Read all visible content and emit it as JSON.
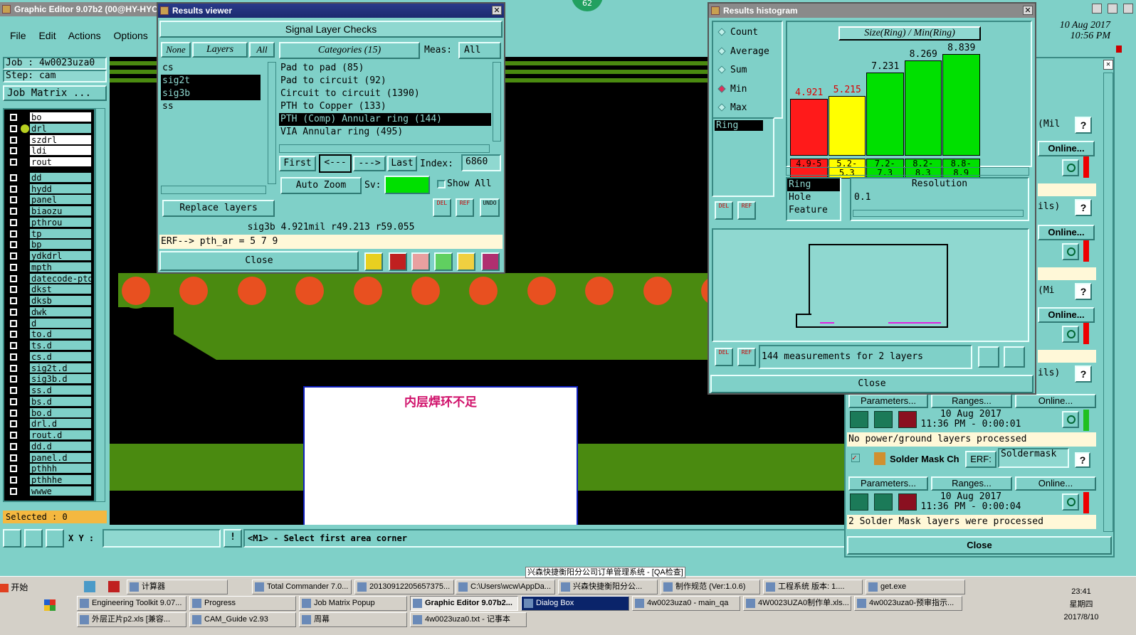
{
  "main": {
    "title": "Graphic Editor 9.07b2 (00@HY-HYCAM",
    "menu": [
      "File",
      "Edit",
      "Actions",
      "Options"
    ],
    "job": "Job : 4w0023uza0",
    "step": "Step: cam",
    "job_matrix": "Job Matrix ...",
    "layers": [
      "bo",
      "drl",
      "szdrl",
      "ldi",
      "rout",
      "dd",
      "hydd",
      "panel",
      "biaozu",
      "pthrou",
      "tp",
      "bp",
      "ydkdrl",
      "mpth",
      "datecode-ptd",
      "dkst",
      "dksb",
      "dwk",
      "d",
      "to.d",
      "ts.d",
      "cs.d",
      "sig2t.d",
      "sig3b.d",
      "ss.d",
      "bs.d",
      "bo.d",
      "drl.d",
      "rout.d",
      "dd.d",
      "panel.d",
      "pthhh",
      "pthhhe",
      "wwwe"
    ],
    "selected": "Selected : 0",
    "xy_label": "X Y :",
    "xy_value": "",
    "status": "<M1> - Select first area corner",
    "date": "10 Aug 2017",
    "time": "10:56 PM",
    "badge": "62",
    "annotation": "内层焊环不足"
  },
  "results": {
    "title": "Results viewer",
    "header": "Signal Layer Checks",
    "none": "None",
    "layers_label": "Layers",
    "all": "All",
    "categories_label": "Categories (15)",
    "meas_label": "Meas:",
    "meas_value": "All",
    "layer_list": [
      "cs",
      "sig2t",
      "sig3b",
      "ss"
    ],
    "categories": [
      "Pad to pad (85)",
      "Pad to circuit (92)",
      "Circuit to circuit (1390)",
      "PTH to Copper (133)",
      "PTH (Comp) Annular ring (144)",
      "VIA Annular ring (495)"
    ],
    "first": "First",
    "prev": "<---",
    "next": "--->",
    "last": "Last",
    "index_label": "Index:",
    "index_value": "6860",
    "auto_zoom": "Auto Zoom",
    "sv": "Sv:",
    "show_all": "Show All",
    "replace_layers": "Replace layers",
    "del": "DEL",
    "ref": "REF",
    "undo": "UNDO",
    "info": "sig3b 4.921mil   r49.213  r59.055",
    "erf": "ERF--> pth_ar = 5 7 9",
    "close": "Close"
  },
  "histogram": {
    "title": "Results histogram",
    "options": [
      "Count",
      "Average",
      "Sum",
      "Min",
      "Max"
    ],
    "selected_option": "Min",
    "list_item": "Ring",
    "chart_title": "Size(Ring) / Min(Ring)",
    "values": [
      "4.921",
      "5.215",
      "7.231",
      "8.269",
      "8.839"
    ],
    "bin_labels": [
      "4.9-5",
      "5.2-5.3",
      "7.2-7.3",
      "8.2-8.3",
      "8.8-8.9"
    ],
    "attrs": [
      "Ring",
      "Hole",
      "Feature"
    ],
    "resolution_label": "Resolution",
    "resolution_value": "0.1",
    "summary": "144 measurements for 2 layers",
    "close": "Close",
    "del": "DEL",
    "ref": "REF"
  },
  "chart_data": {
    "type": "bar",
    "title": "Size(Ring) / Min(Ring)",
    "categories": [
      "4.9-5",
      "5.2-5.3",
      "7.2-7.3",
      "8.2-8.3",
      "8.8-8.9"
    ],
    "values": [
      4.921,
      5.215,
      7.231,
      8.269,
      8.839
    ],
    "colors": [
      "#ff1a1a",
      "#ffff00",
      "#00e000",
      "#00e000",
      "#00e000"
    ]
  },
  "analysis": {
    "items": [
      {
        "label": "(Mil"
      },
      {
        "label": "Online..."
      },
      {
        "label": "ils)"
      },
      {
        "label": "Online..."
      },
      {
        "label": "(Mi"
      },
      {
        "label": "Online..."
      },
      {
        "label": "ils)"
      }
    ],
    "params": "Parameters...",
    "ranges": "Ranges...",
    "online": "Online...",
    "date1": "10 Aug 2017",
    "time1": "11:36 PM - 0:00:01",
    "msg1": "No power/ground layers processed",
    "solder": "Solder Mask Ch",
    "erf": "ERF:",
    "erf_value": "Soldermask",
    "date2": "10 Aug 2017",
    "time2": "11:36 PM - 0:00:04",
    "msg2": "2 Solder Mask layers were processed",
    "close": "Close",
    "help": "?"
  },
  "taskbar": {
    "start": "开始",
    "floating_title": "兴森快捷衡阳分公司订单管理系统 - [QA检查]",
    "row1": [
      "计算器",
      "Total Commander 7.0...",
      "20130912205657375...",
      "C:\\Users\\wcw\\AppDa...",
      "兴森快捷衡阳分公...",
      "制作规范 (Ver:1.0.6)",
      "工程系统  版本: 1....",
      "get.exe"
    ],
    "row2": [
      "Engineering Toolkit 9.07...",
      "Progress",
      "Job Matrix Popup",
      "Graphic Editor 9.07b2...",
      "Dialog Box",
      "4w0023uza0 - main_qa",
      "4W0023UZA0制作单.xls...",
      "4w0023uza0-预审指示..."
    ],
    "row3": [
      "外层正片p2.xls [兼容...",
      "CAM_Guide v2.93",
      "周幕",
      "4w0023uza0.txt - 记事本"
    ],
    "clock": "23:41",
    "weekday": "星期四",
    "date": "2017/8/10"
  }
}
